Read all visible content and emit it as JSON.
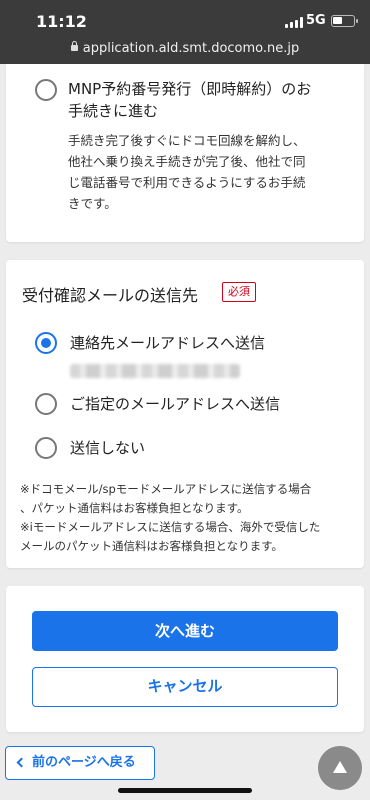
{
  "status": {
    "time": "11:12",
    "network": "5G"
  },
  "browser": {
    "url": "application.ald.smt.docomo.ne.jp"
  },
  "mnp_option": {
    "label_line1": "MNP予約番号発行（即時解約）のお",
    "label_line2": "手続きに進む",
    "desc_line1": "手続き完了後すぐにドコモ回線を解約し、",
    "desc_line2": "他社へ乗り換え手続きが完了後、他社で同",
    "desc_line3": "じ電話番号で利用できるようにするお手続",
    "desc_line4": "きです。"
  },
  "email_section": {
    "title": "受付確認メールの送信先",
    "required_badge": "必須",
    "options": [
      {
        "label": "連絡先メールアドレスへ送信",
        "selected": true
      },
      {
        "label": "ご指定のメールアドレスへ送信",
        "selected": false
      },
      {
        "label": "送信しない",
        "selected": false
      }
    ],
    "notes": [
      "※ドコモメール/spモードメールアドレスに送信する場合",
      "、パケット通信料はお客様負担となります。",
      "※iモードメールアドレスに送信する場合、海外で受信した",
      "メールのパケット通信料はお客様負担となります。"
    ]
  },
  "actions": {
    "next_label": "次へ進む",
    "cancel_label": "キャンセル"
  },
  "footer": {
    "back_label": "前のページへ戻る"
  },
  "colors": {
    "accent": "#1a73e8",
    "required": "#d0021b"
  }
}
